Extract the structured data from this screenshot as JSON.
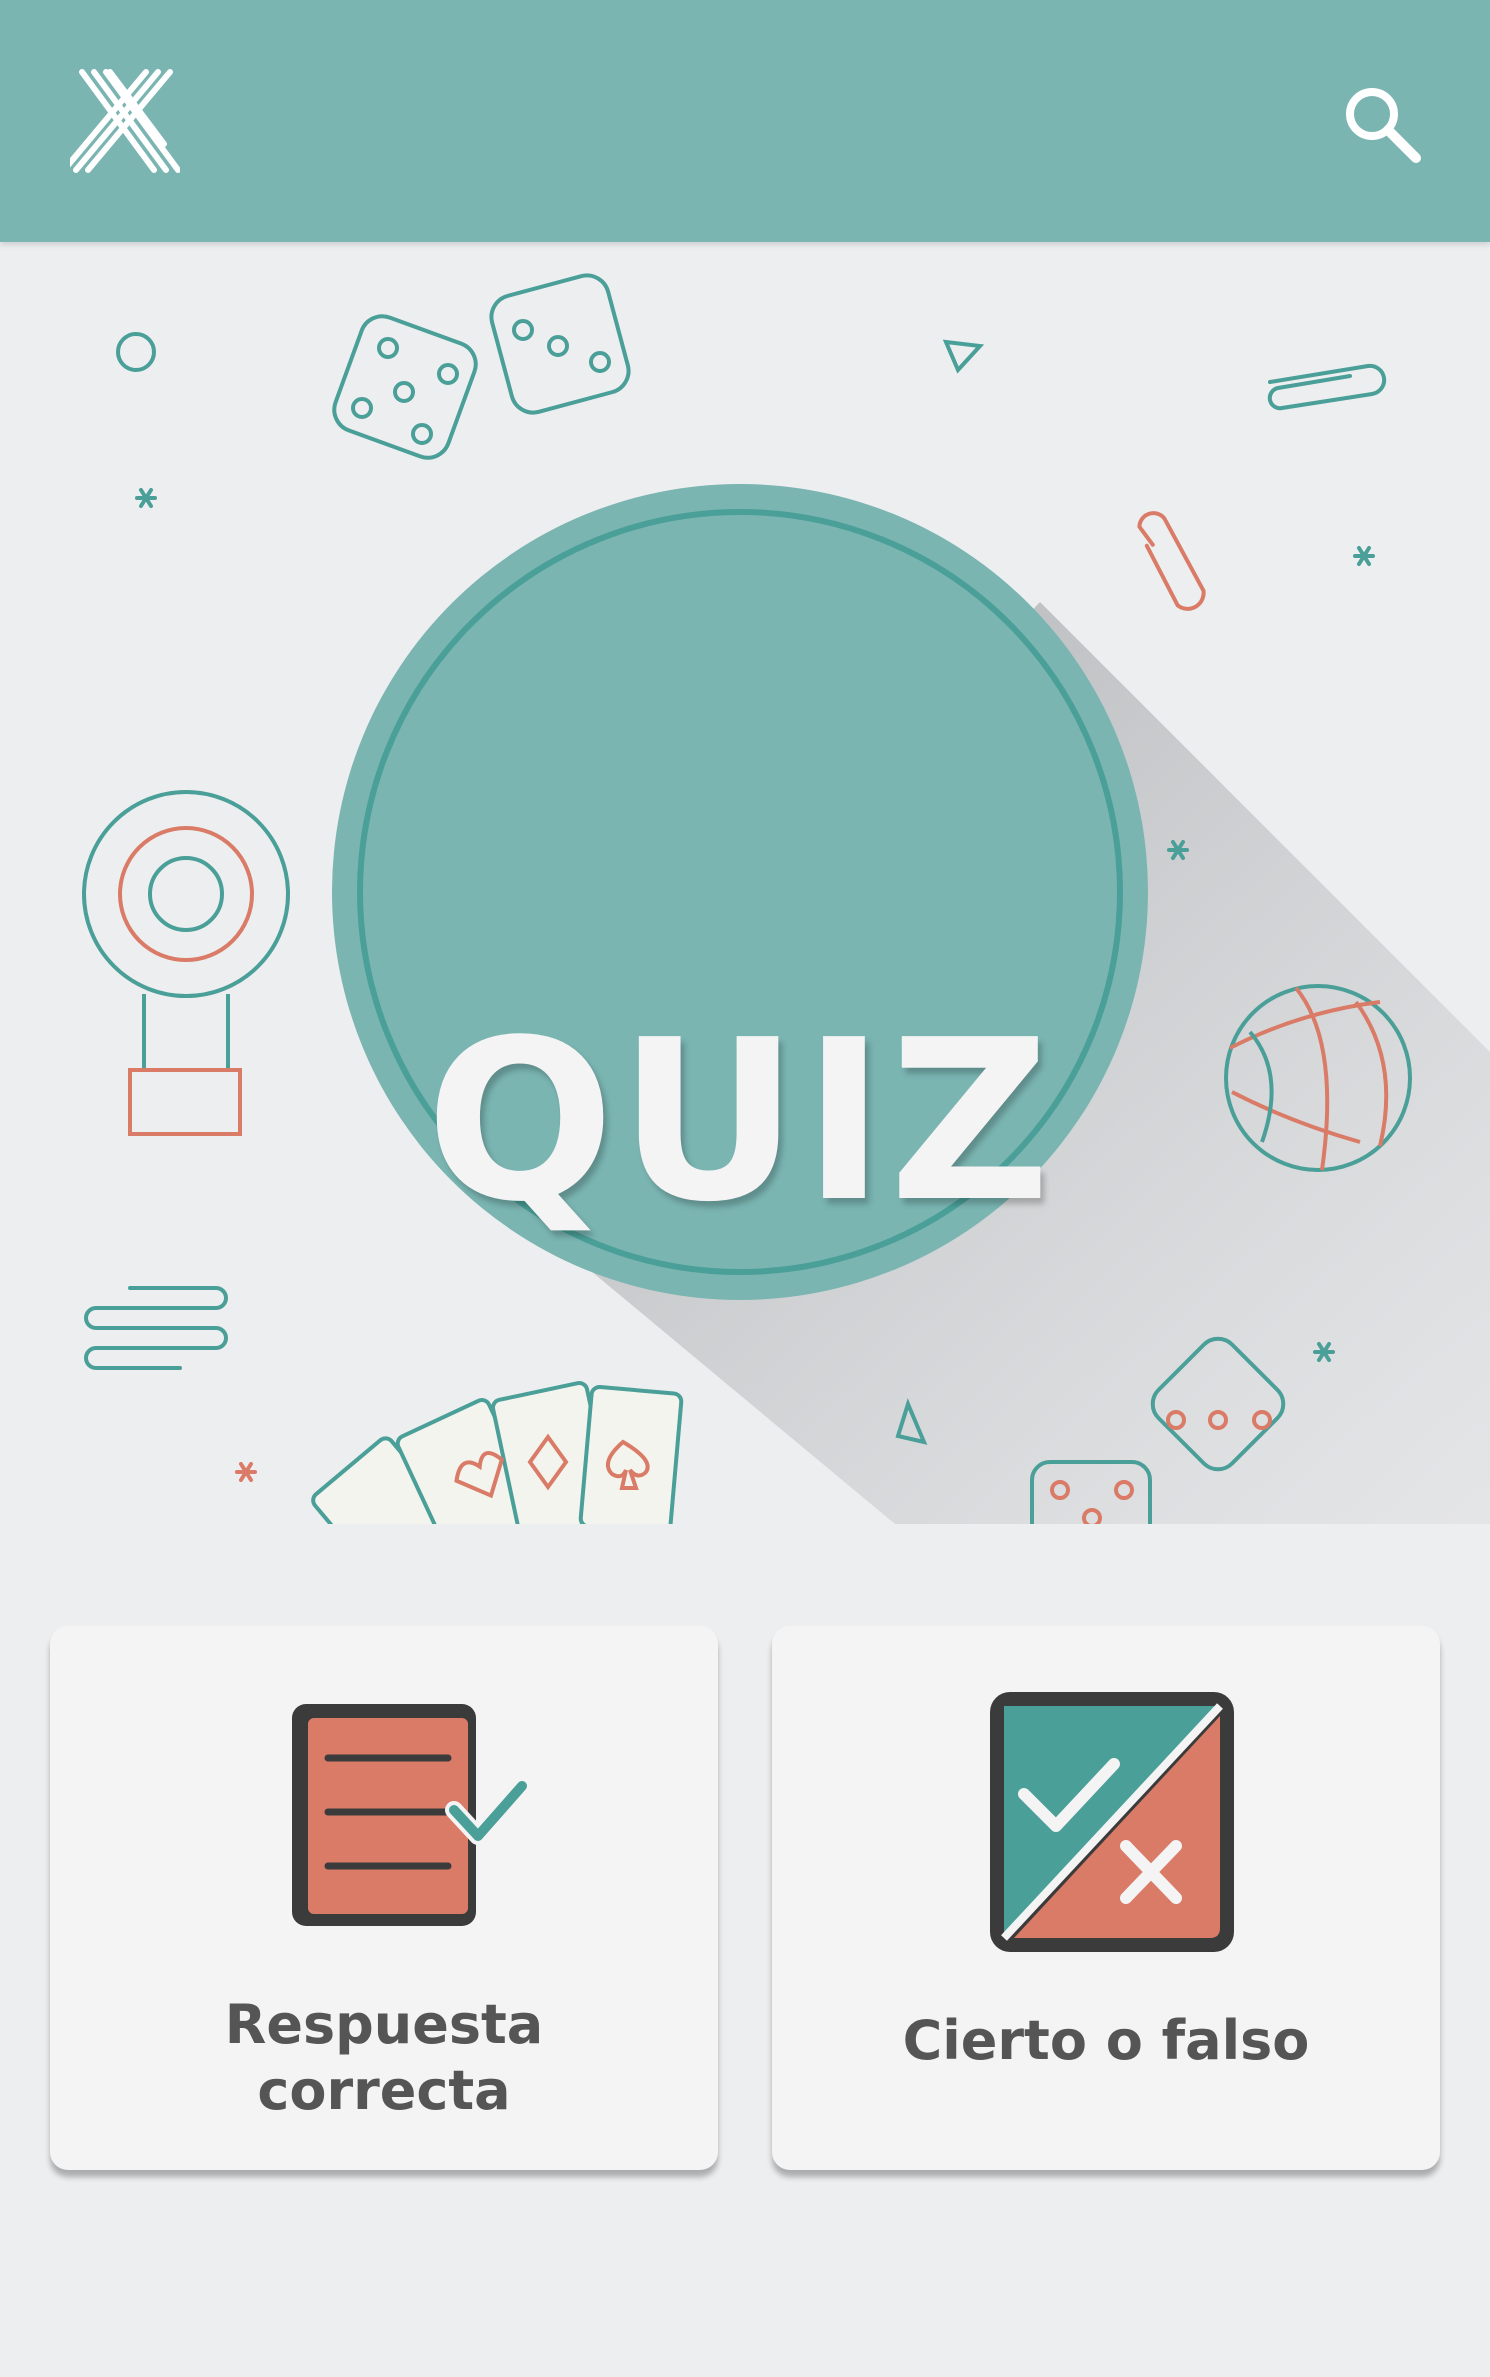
{
  "header": {
    "logo_icon": "crossed-x-logo-icon",
    "search_icon": "search-icon",
    "color": "#7ab5b2"
  },
  "hero": {
    "title": "QUIZ",
    "circle_color": "#7ab5b2",
    "ring_color": "#4a9f98",
    "accent_teal": "#4a9f98",
    "accent_orange": "#d97b66"
  },
  "options": [
    {
      "label_line1": "Respuesta",
      "label_line2": "correcta",
      "icon": "document-check-icon"
    },
    {
      "label": "Cierto o falso",
      "icon": "true-false-icon"
    }
  ]
}
